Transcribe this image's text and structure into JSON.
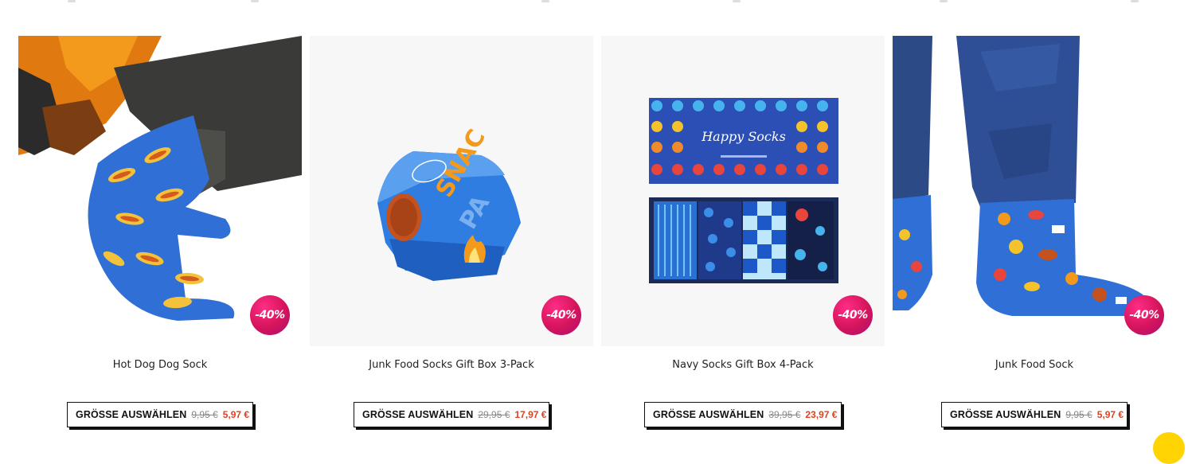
{
  "products": [
    {
      "name": "Hot Dog Dog Sock",
      "badge": "-40%",
      "button_label": "GRÖSSE AUSWÄHLEN",
      "old_price": "9,95 €",
      "new_price": "5,97 €"
    },
    {
      "name": "Junk Food Socks Gift Box 3-Pack",
      "badge": "-40%",
      "button_label": "GRÖSSE AUSWÄHLEN",
      "old_price": "29,95 €",
      "new_price": "17,97 €"
    },
    {
      "name": "Navy Socks Gift Box 4-Pack",
      "badge": "-40%",
      "button_label": "GRÖSSE AUSWÄHLEN",
      "old_price": "39,95 €",
      "new_price": "23,97 €"
    },
    {
      "name": "Junk Food Sock",
      "badge": "-40%",
      "button_label": "GRÖSSE AUSWÄHLEN",
      "old_price": "9,95 €",
      "new_price": "5,97 €"
    }
  ],
  "colors": {
    "badge": "#d4145a",
    "sale_price": "#e2401c",
    "sock_blue": "#2f6fd6",
    "chat_bubble": "#ffd400"
  },
  "icons": {
    "chat": "chat-bubble-icon"
  }
}
